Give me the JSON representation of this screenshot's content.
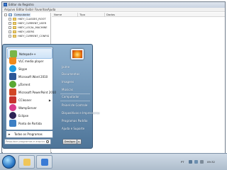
{
  "regedit": {
    "title": "Editor do Registro",
    "menu": [
      "Arquivo",
      "Editar",
      "Exibir",
      "Favoritos",
      "Ajuda"
    ],
    "tree": [
      {
        "label": "Computador",
        "selected": true
      },
      {
        "label": "HKEY_CLASSES_ROOT"
      },
      {
        "label": "HKEY_CURRENT_USER"
      },
      {
        "label": "HKEY_LOCAL_MACHINE"
      },
      {
        "label": "HKEY_USERS"
      },
      {
        "label": "HKEY_CURRENT_CONFIG"
      }
    ],
    "columns": [
      "Nome",
      "Tipo",
      "Dados"
    ]
  },
  "start_menu": {
    "programs": [
      {
        "label": "Notepad++",
        "icon": "notepad-plus-icon",
        "color": "#7ab648"
      },
      {
        "label": "VLC media player",
        "icon": "vlc-icon",
        "color": "#f08a1c"
      },
      {
        "label": "Skype",
        "icon": "skype-icon",
        "color": "#1e9be0"
      },
      {
        "label": "Microsoft Word 2010",
        "icon": "word-icon",
        "color": "#2b5797"
      },
      {
        "label": "μTorrent",
        "icon": "utorrent-icon",
        "color": "#5aa832"
      },
      {
        "label": "Microsoft PowerPoint 2010",
        "icon": "powerpoint-icon",
        "color": "#d24726"
      },
      {
        "label": "CCleaner",
        "icon": "ccleaner-icon",
        "color": "#c8322e",
        "has_submenu": true
      },
      {
        "label": "WampServer",
        "icon": "wampserver-icon",
        "color": "#d93a8c"
      },
      {
        "label": "Eclipse",
        "icon": "eclipse-icon",
        "color": "#2c2255"
      },
      {
        "label": "Ponto de Partida",
        "icon": "getting-started-icon",
        "color": "#3c7fc4"
      }
    ],
    "all_programs": "Todos os Programas",
    "search_placeholder": "Pesquisar programas e arquivos",
    "right_links": [
      {
        "label": "Jaime"
      },
      {
        "label": "Documentos"
      },
      {
        "label": "Imagens"
      },
      {
        "label": "Músicas"
      },
      {
        "label": "Computador"
      },
      {
        "label": "Painel de Controle"
      },
      {
        "label": "Dispositivos e Impressoras"
      },
      {
        "label": "Programas Padrão"
      },
      {
        "label": "Ajuda e Suporte"
      }
    ],
    "shutdown_label": "Desligar"
  },
  "taskbar": {
    "language": "PT",
    "clock": "09:32",
    "colors": {
      "accent": "#2d79c7"
    }
  }
}
